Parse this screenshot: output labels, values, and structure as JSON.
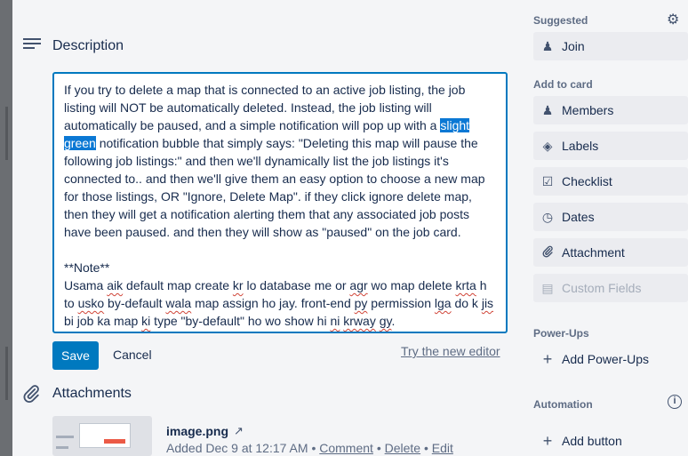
{
  "description": {
    "title": "Description",
    "para1_before": "If you try to delete a map that is connected to an active job listing, the job listing will NOT be automatically deleted. Instead, the job listing will automatically be paused, and a simple notification will pop up with a ",
    "para1_highlight": "slight green",
    "para1_after": " notification bubble that simply says: \"Deleting this map will pause the following job listings:\" and then we'll dynamically list the job listings it's connected to.. and then we'll give them an easy option to choose a new map for those listings, OR \"Ignore, Delete Map\". if they click ignore delete map, then they will get a notification alerting them that any associated job posts have been paused. and then they will show as \"paused\" on the job card.",
    "note_heading": "**Note**",
    "note_parts": [
      "Usama ",
      "aik",
      " default map create ",
      "kr",
      " lo database me or ",
      "agr",
      " wo map delete ",
      "krta",
      " h to ",
      "usko",
      " by-default ",
      "wala",
      " map assign ho jay. front-end ",
      "py",
      " permission ",
      "lga",
      " do k ",
      "jis",
      " bi job ka map ",
      "ki",
      " type \"by-default\" ho wo show hi ",
      "ni",
      " ",
      "krway",
      " ",
      "gy",
      "."
    ],
    "save_label": "Save",
    "cancel_label": "Cancel",
    "new_editor_label": "Try the new editor"
  },
  "attachments": {
    "title": "Attachments",
    "items": [
      {
        "name": "image.png",
        "open_glyph": "↗",
        "added": "Added Dec 9 at 12:17 AM",
        "sep": " • ",
        "comment": "Comment",
        "delete": "Delete",
        "edit": "Edit"
      }
    ]
  },
  "sidebar": {
    "suggested_label": "Suggested",
    "join_label": "Join",
    "add_to_card_label": "Add to card",
    "items": [
      {
        "label": "Members",
        "icon": "person-icon"
      },
      {
        "label": "Labels",
        "icon": "tag-icon"
      },
      {
        "label": "Checklist",
        "icon": "checklist-icon"
      },
      {
        "label": "Dates",
        "icon": "clock-icon"
      },
      {
        "label": "Attachment",
        "icon": "paperclip-icon"
      },
      {
        "label": "Custom Fields",
        "icon": "custom-fields-icon"
      }
    ],
    "powerups_label": "Power-Ups",
    "add_powerups_label": "Add Power-Ups",
    "automation_label": "Automation",
    "add_button_label": "Add button"
  }
}
